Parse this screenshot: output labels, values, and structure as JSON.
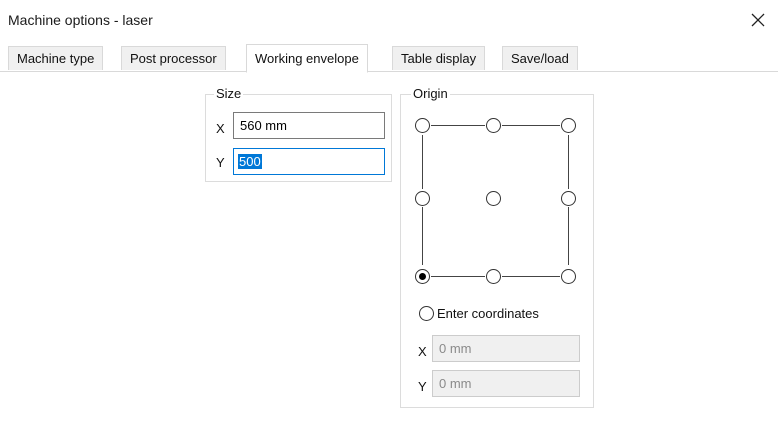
{
  "window": {
    "title": "Machine options - laser",
    "close_icon": "close-icon"
  },
  "tabs": [
    {
      "label": "Machine type"
    },
    {
      "label": "Post processor"
    },
    {
      "label": "Working envelope",
      "active": true
    },
    {
      "label": "Table display"
    },
    {
      "label": "Save/load"
    }
  ],
  "size": {
    "legend": "Size",
    "x_label": "X",
    "x_value": "560 mm",
    "y_label": "Y",
    "y_value": "500"
  },
  "origin": {
    "legend": "Origin",
    "selected": "bottom-left",
    "enter_coordinates_label": "Enter coordinates",
    "x_label": "X",
    "x_value": "0 mm",
    "y_label": "Y",
    "y_value": "0 mm"
  }
}
